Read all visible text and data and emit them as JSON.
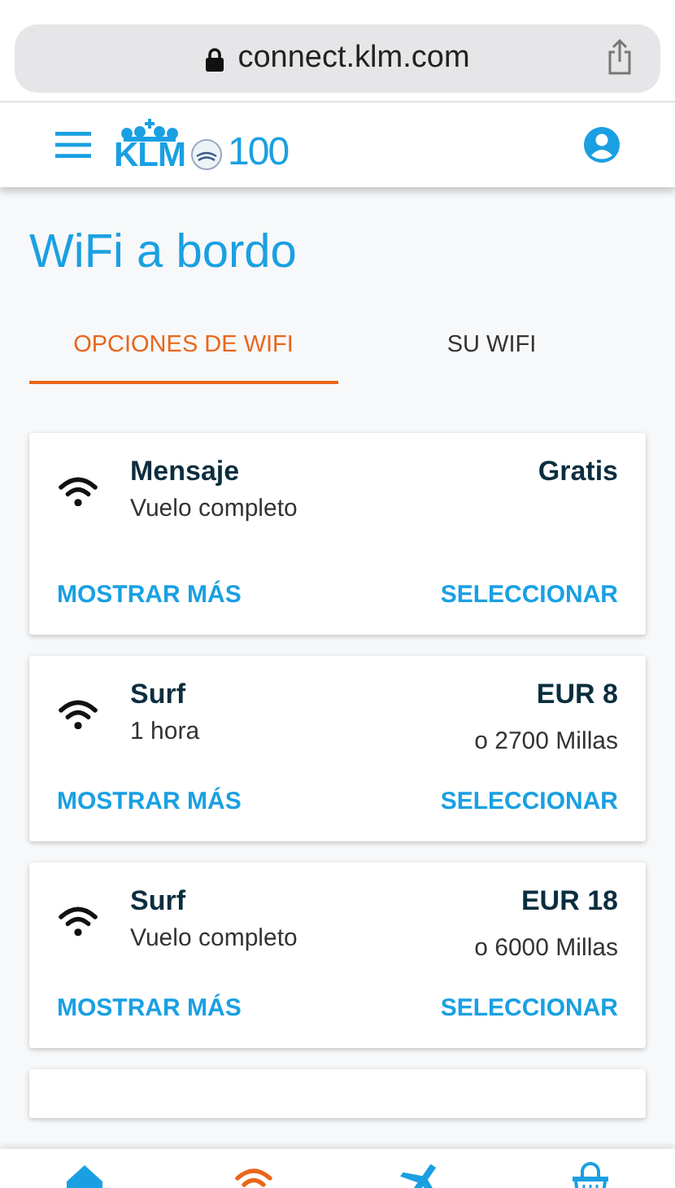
{
  "browser": {
    "url": "connect.klm.com"
  },
  "header": {
    "logo_text": "KLM",
    "anniversary_text": "100"
  },
  "title": "WiFi a bordo",
  "tabs": [
    {
      "label": "OPCIONES DE WIFI",
      "selected": true
    },
    {
      "label": "SU WIFI",
      "selected": false
    }
  ],
  "offers": [
    {
      "name": "Mensaje",
      "duration": "Vuelo completo",
      "price": "Gratis",
      "actions": [
        "MOSTRAR MÁS",
        "SELECCIONAR"
      ]
    },
    {
      "name": "Surf",
      "duration": "1 hora",
      "price": "EUR 8",
      "alt_price": "o 2700 Millas",
      "actions": [
        "MOSTRAR MÁS",
        "SELECCIONAR"
      ]
    },
    {
      "name": "Surf",
      "duration": "Vuelo completo",
      "price": "EUR 18",
      "alt_price": "o 6000 Millas",
      "actions": [
        "MOSTRAR MÁS",
        "SELECCIONAR"
      ]
    }
  ],
  "bottom_nav": [
    {
      "kind": "home",
      "selected": false
    },
    {
      "kind": "wifi",
      "selected": true
    },
    {
      "kind": "plane",
      "selected": false
    },
    {
      "kind": "bag",
      "selected": false
    }
  ]
}
